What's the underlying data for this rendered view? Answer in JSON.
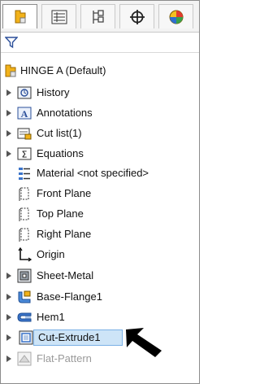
{
  "tabs": [
    {
      "name": "feature-manager"
    },
    {
      "name": "property-manager"
    },
    {
      "name": "configuration-manager"
    },
    {
      "name": "dimxpert-manager"
    },
    {
      "name": "display-manager"
    }
  ],
  "tree": {
    "root_label": "HINGE A  (Default)",
    "items": [
      {
        "label": "History",
        "icon": "history-icon",
        "caret": true
      },
      {
        "label": "Annotations",
        "icon": "annotations-icon",
        "caret": true
      },
      {
        "label": "Cut list(1)",
        "icon": "cut-list-icon",
        "caret": true
      },
      {
        "label": "Equations",
        "icon": "equations-icon",
        "caret": true
      },
      {
        "label": "Material <not specified>",
        "icon": "material-icon",
        "caret": false
      },
      {
        "label": "Front Plane",
        "icon": "plane-icon",
        "caret": false
      },
      {
        "label": "Top Plane",
        "icon": "plane-icon",
        "caret": false
      },
      {
        "label": "Right Plane",
        "icon": "plane-icon",
        "caret": false
      },
      {
        "label": "Origin",
        "icon": "origin-icon",
        "caret": false
      },
      {
        "label": "Sheet-Metal",
        "icon": "sheet-metal-icon",
        "caret": true
      },
      {
        "label": "Base-Flange1",
        "icon": "base-flange-icon",
        "caret": true
      },
      {
        "label": "Hem1",
        "icon": "hem-icon",
        "caret": true
      },
      {
        "label": "Cut-Extrude1",
        "icon": "cut-extrude-icon",
        "caret": true,
        "selected": true
      },
      {
        "label": "Flat-Pattern",
        "icon": "flat-pattern-icon",
        "caret": true,
        "suppressed": true
      }
    ]
  },
  "colors": {
    "selection_fill": "#cde4f7",
    "selection_border": "#7ab0e6",
    "suppressed_text": "#9a9a9a",
    "feature_yellow": "#f2b21a",
    "feature_blue": "#3a73c9"
  }
}
